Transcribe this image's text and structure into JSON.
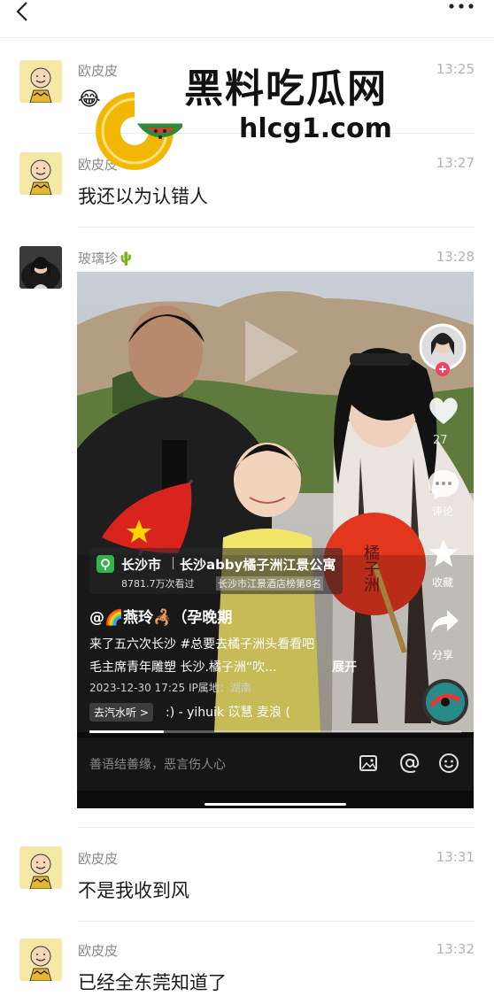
{
  "header": {
    "back_icon": "chevron-left-icon",
    "more_icon": "ellipsis-icon"
  },
  "watermark": {
    "title": "黑料吃瓜网",
    "url": "hlcg1.com",
    "logo_icon": "watermelon-logo-icon"
  },
  "messages": [
    {
      "sender": "欧皮皮",
      "time": "13:25",
      "text": "😂"
    },
    {
      "sender": "欧皮皮",
      "time": "13:27",
      "text": "我还以为认错人"
    },
    {
      "sender": "玻璃珍🌵",
      "time": "13:28"
    },
    {
      "sender": "欧皮皮",
      "time": "13:31",
      "text": "不是我收到风"
    },
    {
      "sender": "欧皮皮",
      "time": "13:32",
      "text": "已经全东莞知道了"
    }
  ],
  "video": {
    "sidebar": {
      "like_count": "27",
      "comment_label": "评论",
      "favorite_label": "收藏",
      "share_label": "分享"
    },
    "location": {
      "city": "长沙市",
      "place": "长沙abby橘子洲江景公寓",
      "views": "8781.7万次看过",
      "rank": "长沙市江景酒店榜第8名"
    },
    "author": "@🌈燕玲🦂（孕晚期",
    "caption_line1": "来了五六次长沙 #总要去橘子洲头看看吧",
    "caption_line2": "毛主席青年雕塑 长沙.橘子洲“吹...",
    "expand_label": "展开",
    "meta": "2023-12-30 17:25 IP属地：湖南",
    "music_tag": "去汽水听 >",
    "music": ":) - yihuik 苡慧    麦浪 (",
    "progress": 0.2,
    "comment_placeholder": "善语结善缘，恶言伤人心",
    "fan_text": "橘子洲"
  }
}
